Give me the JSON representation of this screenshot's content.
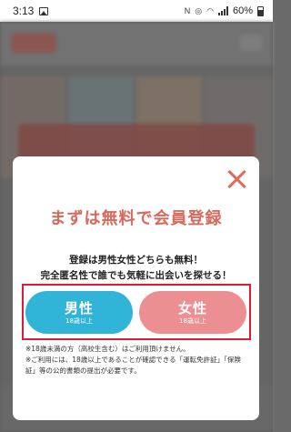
{
  "status_bar": {
    "time": "3:13",
    "battery": "60%",
    "icons": [
      "image-icon",
      "nfc-icon",
      "hotspot-icon",
      "wifi-icon",
      "signal-icon",
      "battery-icon"
    ]
  },
  "modal": {
    "title": "まずは無料で会員登録",
    "lead_line1": "登録は男性女性どちらも無料！",
    "lead_line2": "完全匿名性で誰でも気軽に出会いを探せる！",
    "male_label": "男性",
    "male_sub": "18歳以上",
    "female_label": "女性",
    "female_sub": "18歳以上",
    "note1": "※18歳未満の方（高校生含む）はご利用頂けません。",
    "note2": "※ご利用には、18歳以上であることが確認できる「運転免許証」「保険証」等の公的書類の提出が必要です。"
  },
  "colors": {
    "accent": "#d9695c",
    "male": "#30b4d8",
    "female": "#ec8f93",
    "highlight_frame": "#e01a32"
  }
}
